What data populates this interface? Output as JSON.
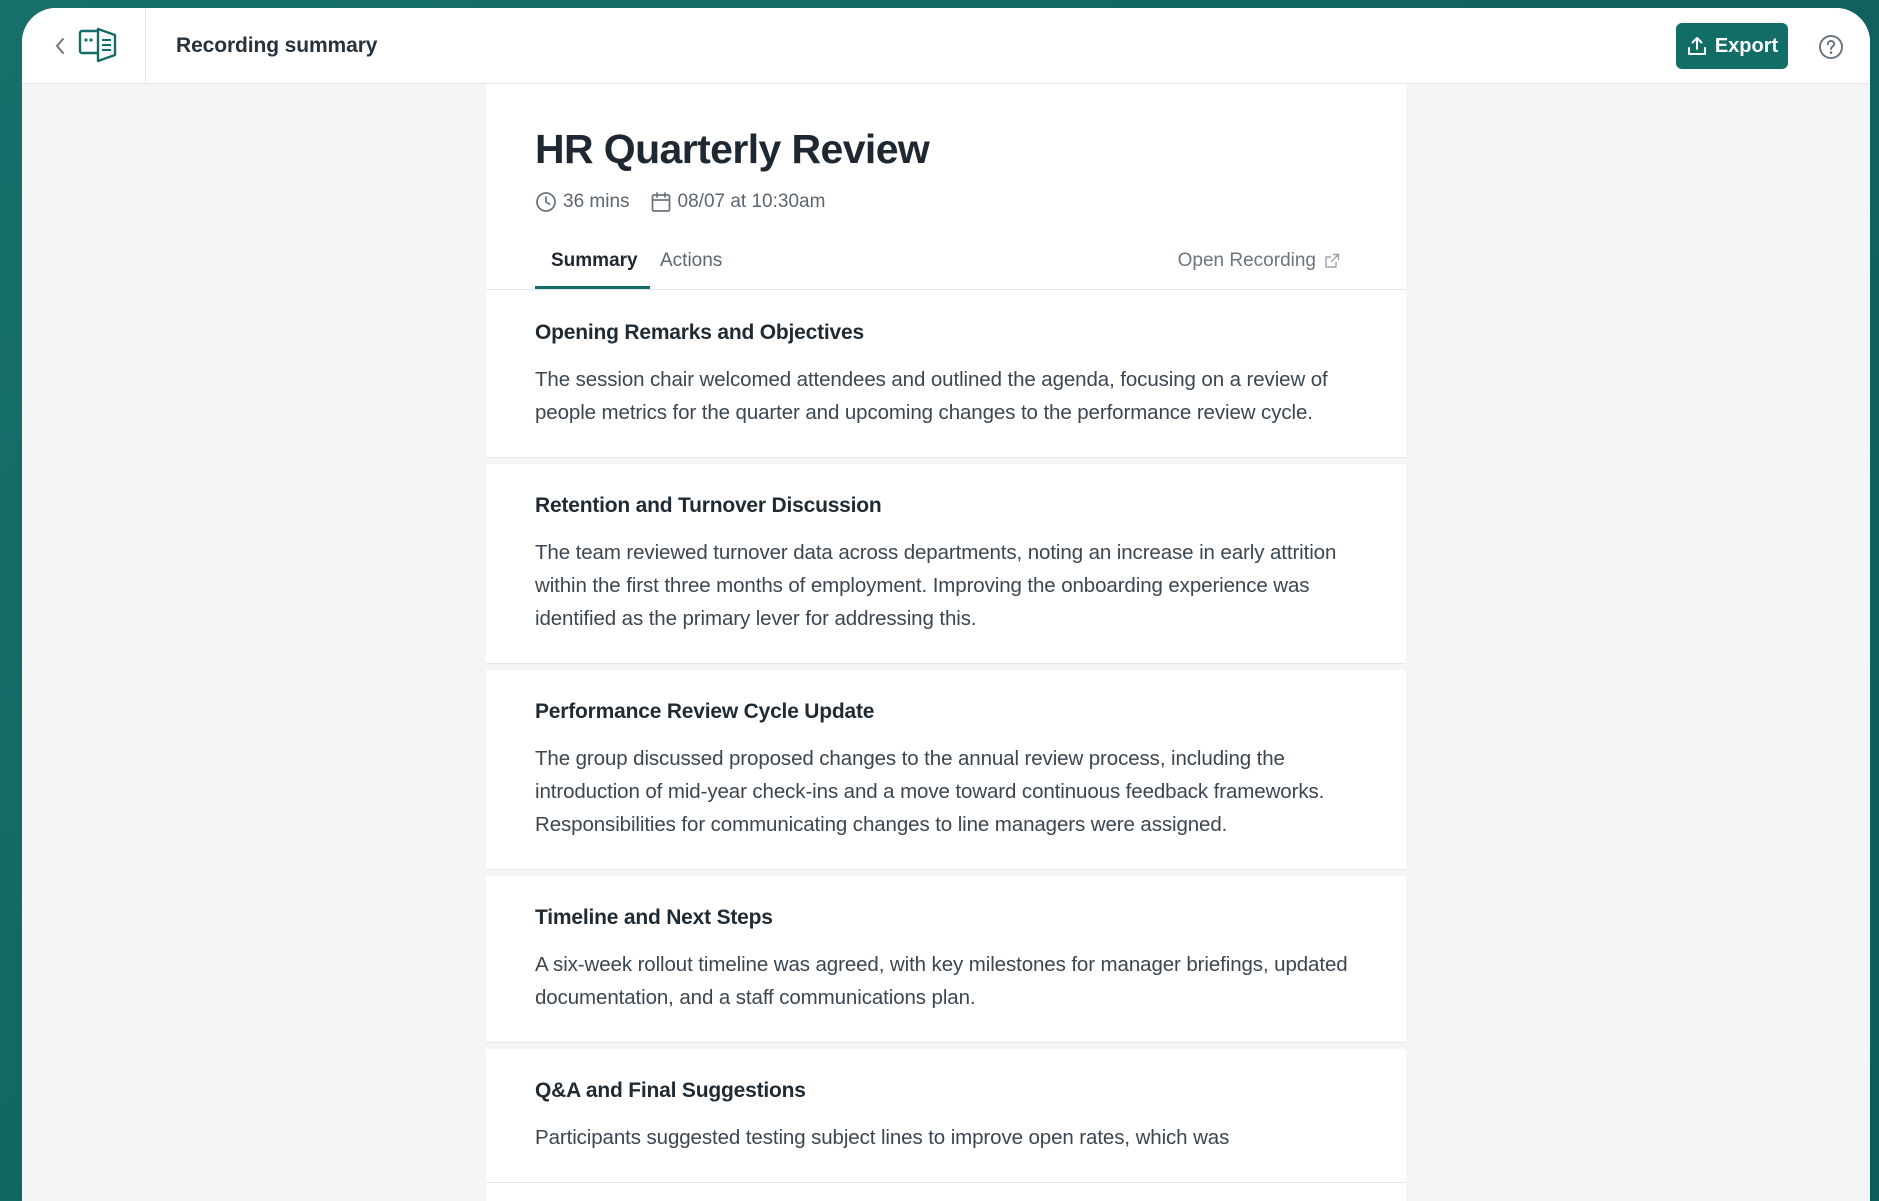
{
  "topbar": {
    "title": "Recording summary",
    "export_label": "Export"
  },
  "meeting": {
    "title": "HR Quarterly Review",
    "duration": "36 mins",
    "datetime": "08/07 at 10:30am"
  },
  "tabs": [
    {
      "label": "Summary",
      "active": true
    },
    {
      "label": "Actions",
      "active": false
    }
  ],
  "open_recording_label": "Open Recording",
  "sections": [
    {
      "heading": "Opening Remarks and Objectives",
      "body": "The session chair welcomed attendees and outlined the agenda, focusing on a review of people metrics for the quarter and upcoming changes to the performance review cycle."
    },
    {
      "heading": "Retention and Turnover Discussion",
      "body": "The team reviewed turnover data across departments, noting an increase in early attrition within the first three months of employment. Improving the onboarding experience was identified as the primary lever for addressing this."
    },
    {
      "heading": "Performance Review Cycle Update",
      "body": "The group discussed proposed changes to the annual review process, including the introduction of mid-year check-ins and a move toward continuous feedback frameworks. Responsibilities for communicating changes to line managers were assigned."
    },
    {
      "heading": "Timeline and Next Steps",
      "body": "A six-week rollout timeline was agreed, with key milestones for manager briefings, updated documentation, and a staff communications plan."
    },
    {
      "heading": "Q&A and Final Suggestions",
      "body": "Participants suggested testing subject lines to improve open rates, which was"
    }
  ],
  "colors": {
    "accent": "#136d67",
    "background": "#f4f5f6",
    "frame": "#136c66"
  },
  "icons": {
    "back": "chevron-left-icon",
    "logo": "app-logo-icon",
    "export": "upload-icon",
    "help": "help-circle-icon",
    "duration": "clock-icon",
    "date": "calendar-icon",
    "open_recording": "external-link-icon"
  }
}
